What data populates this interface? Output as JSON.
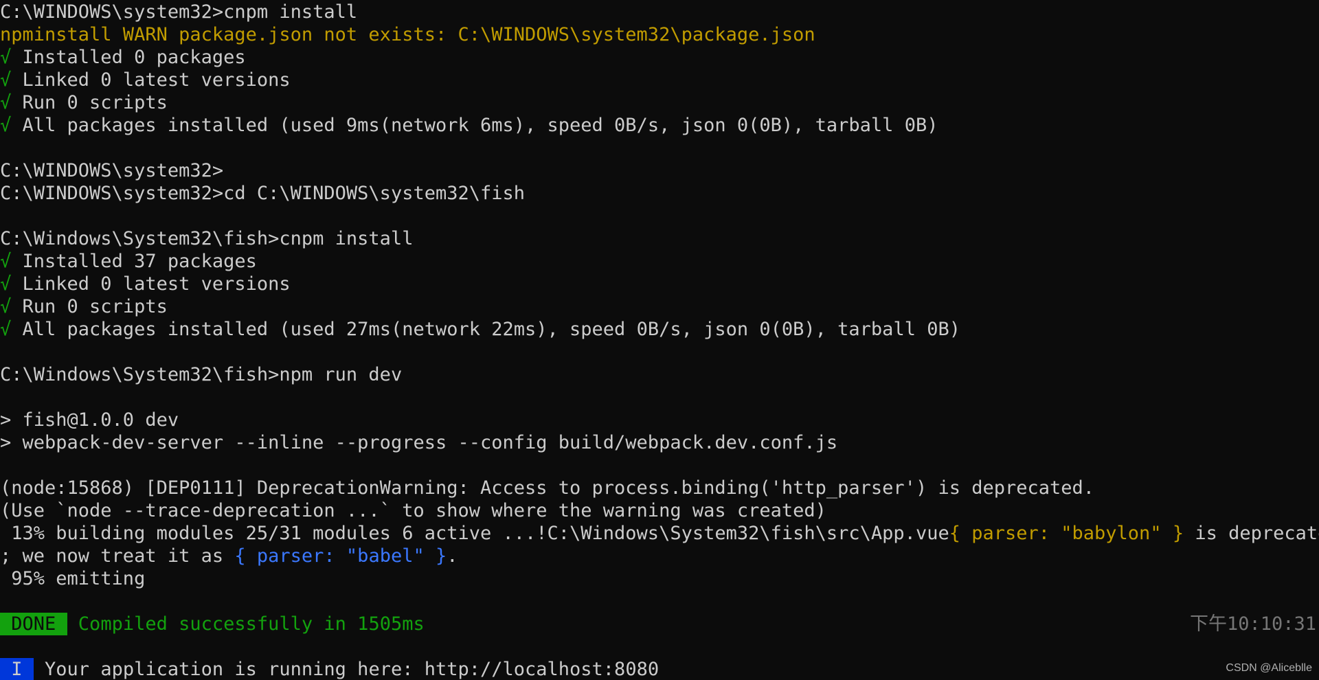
{
  "terminal": {
    "colors": {
      "background": "#0c0c0c",
      "foreground": "#cccccc",
      "warn": "#c19c00",
      "success": "#13a10e",
      "info_badge": "#0037da",
      "link_blue": "#3b78ff"
    },
    "lines": {
      "l1": "C:\\WINDOWS\\system32>cnpm install",
      "l2": "npminstall WARN package.json not exists: C:\\WINDOWS\\system32\\package.json",
      "l3": "√",
      "l3t": " Installed 0 packages",
      "l4": "√",
      "l4t": " Linked 0 latest versions",
      "l5": "√",
      "l5t": " Run 0 scripts",
      "l6": "√",
      "l6t": " All packages installed (used 9ms(network 6ms), speed 0B/s, json 0(0B), tarball 0B)",
      "l8": "C:\\WINDOWS\\system32>",
      "l9": "C:\\WINDOWS\\system32>cd C:\\WINDOWS\\system32\\fish",
      "l11": "C:\\Windows\\System32\\fish>cnpm install",
      "l12": "√",
      "l12t": " Installed 37 packages",
      "l13": "√",
      "l13t": " Linked 0 latest versions",
      "l14": "√",
      "l14t": " Run 0 scripts",
      "l15": "√",
      "l15t": " All packages installed (used 27ms(network 22ms), speed 0B/s, json 0(0B), tarball 0B)",
      "l17": "C:\\Windows\\System32\\fish>npm run dev",
      "l19": "> fish@1.0.0 dev",
      "l20": "> webpack-dev-server --inline --progress --config build/webpack.dev.conf.js",
      "l22": "(node:15868) [DEP0111] DeprecationWarning: Access to process.binding('http_parser') is deprecated.",
      "l23": "(Use `node --trace-deprecation ...` to show where the warning was created)",
      "l24a": " 13% building modules 25/31 modules 6 active ...!C:\\Windows\\System32\\fish\\src\\App.vue",
      "l24b": "{ parser: \"babylon\" }",
      "l24c": " is deprecated",
      "l25a": "; we now treat it as ",
      "l25b": "{ parser: \"babel\" }",
      "l25c": ".",
      "l26": " 95% emitting",
      "done_badge": " DONE ",
      "done_text": " Compiled successfully in 1505ms",
      "timestamp": "下午10:10:31",
      "info_badge": " I ",
      "info_text": " Your application is running here: http://localhost:8080"
    },
    "watermark": "CSDN @Aliceblle"
  }
}
